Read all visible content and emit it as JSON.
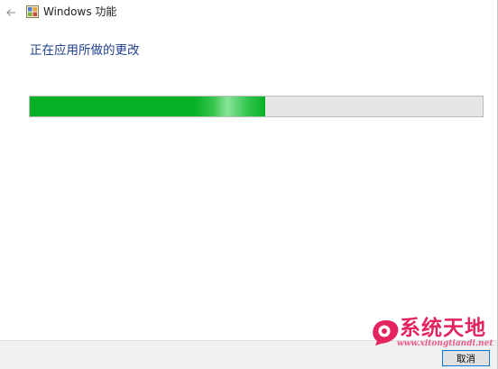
{
  "window": {
    "title": "Windows 功能",
    "back_icon": "back-arrow-icon",
    "app_icon": "windows-features-icon"
  },
  "main": {
    "heading": "正在应用所做的更改",
    "progress": {
      "percent": 52,
      "fill_color": "#06b025",
      "track_color": "#e6e6e6"
    }
  },
  "footer": {
    "cancel_label": "取消"
  },
  "watermark": {
    "text": "系统天地",
    "url": "www.xitongtiandi.net",
    "color": "#e3245f"
  }
}
